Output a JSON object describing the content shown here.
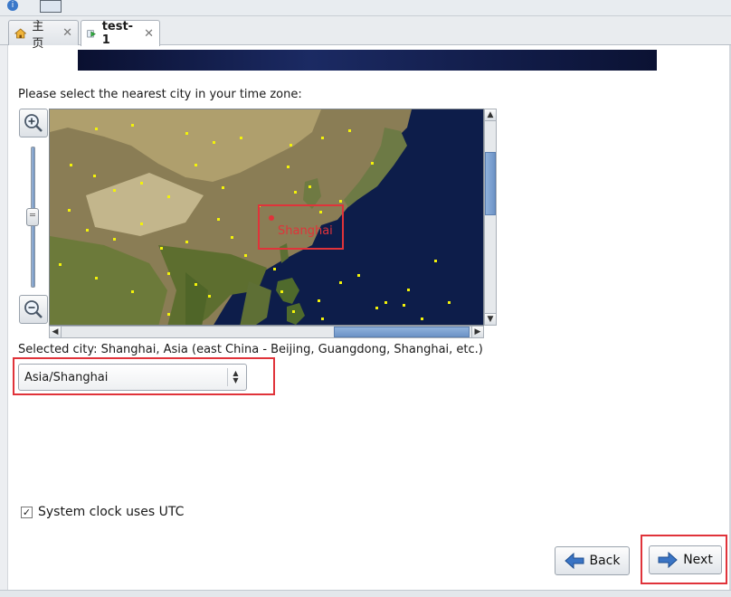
{
  "tabs": [
    {
      "label": "主页",
      "icon": "home-icon"
    },
    {
      "label": "test-1",
      "icon": "vm-run-icon"
    }
  ],
  "timezone": {
    "prompt": "Please select the nearest city in your time zone:",
    "map_marker_label": "Shanghai",
    "selected_city_text": "Selected city: Shanghai, Asia (east China - Beijing, Guangdong, Shanghai, etc.)",
    "selected_zone": "Asia/Shanghai",
    "utc_label": "System clock uses UTC",
    "utc_checked": true
  },
  "buttons": {
    "back": "Back",
    "next": "Next"
  },
  "colors": {
    "highlight": "#e0333a",
    "map_ocean": "#0d1d4a",
    "city_dot": "#f2f20a"
  }
}
